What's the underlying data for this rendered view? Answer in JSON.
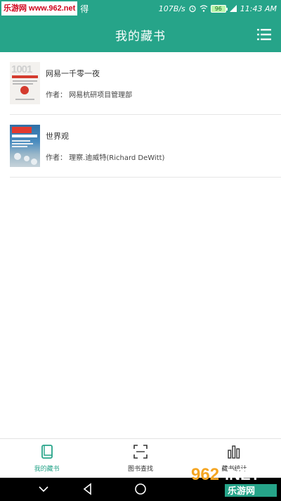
{
  "status_bar": {
    "watermark_text": "乐游网 www.962.net",
    "extra_text": "得",
    "network_speed": "107B/s",
    "battery": "96",
    "time": "11:43 AM"
  },
  "header": {
    "title": "我的藏书",
    "menu_icon": "list-menu-icon"
  },
  "books": [
    {
      "title": "网易一千零一夜",
      "author": "作者： 网易杭研项目管理部"
    },
    {
      "title": "世界观",
      "author": "作者： 理察.迪威特(Richard DeWitt)"
    }
  ],
  "bottom_nav": {
    "tabs": [
      {
        "label": "我的藏书",
        "icon": "book-icon",
        "active": true
      },
      {
        "label": "图书查找",
        "icon": "scan-icon",
        "active": false
      },
      {
        "label": "藏书统计",
        "icon": "bar-chart-icon",
        "active": false
      }
    ]
  },
  "colors": {
    "primary": "#26a489",
    "active_tab": "#26a489",
    "background": "#ffffff"
  },
  "corner_watermark": "962.NET 乐游网"
}
